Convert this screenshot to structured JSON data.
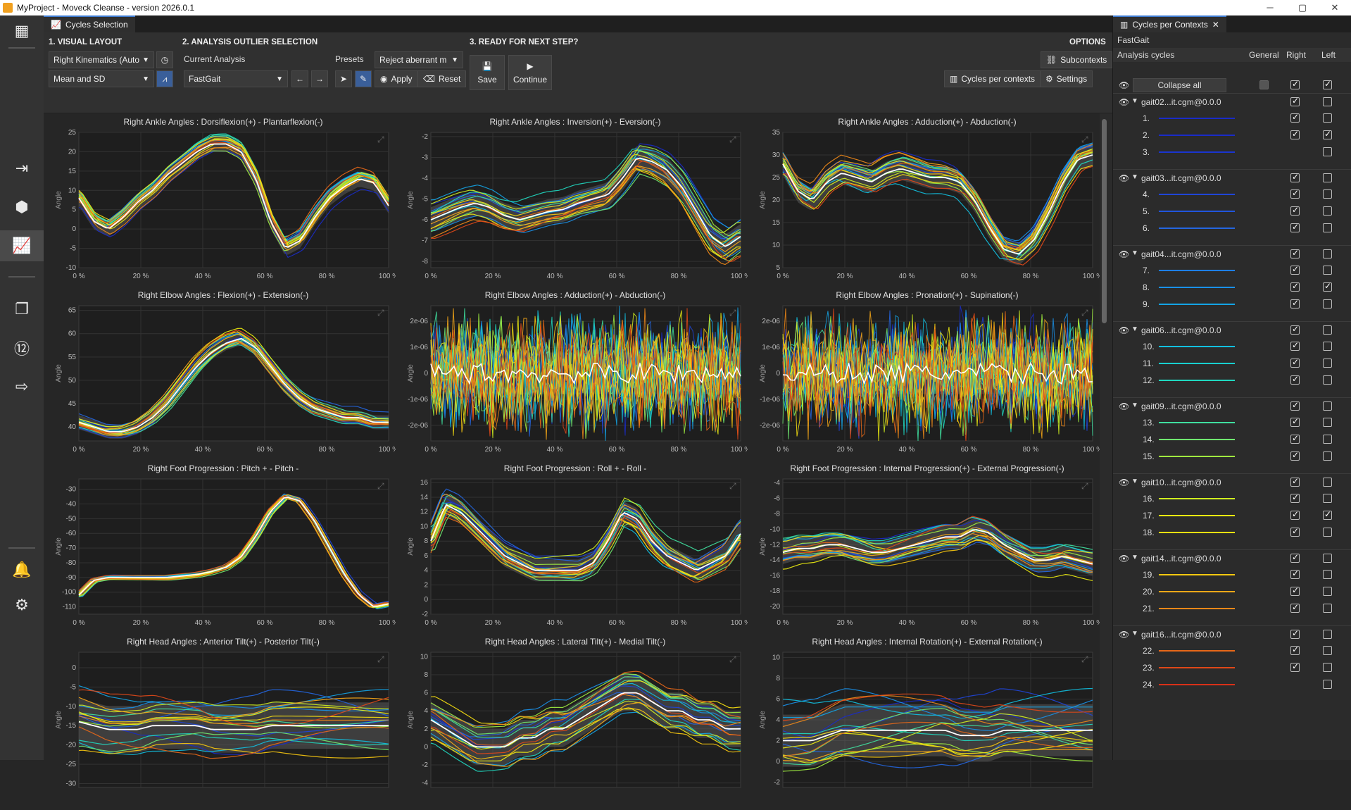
{
  "window": {
    "title": "MyProject - Moveck Cleanse - version 2026.0.1",
    "minimize": "─",
    "maximize": "▢",
    "close": "✕"
  },
  "main_tab": "Cycles Selection",
  "toolbar": {
    "visual_layout_title": "1. VISUAL LAYOUT",
    "analysis_title": "2. ANALYSIS OUTLIER SELECTION",
    "ready_title": "3. READY FOR NEXT STEP?",
    "options_title": "OPTIONS",
    "layout_select": "Right Kinematics (Auto",
    "stat_select": "Mean and SD",
    "current_analysis_label": "Current Analysis",
    "analysis_select": "FastGait",
    "presets_label": "Presets",
    "presets_select": "Reject aberrant m",
    "apply_label": "Apply",
    "reset_label": "Reset",
    "save_label": "Save",
    "continue_label": "Continue",
    "subcontexts_label": "Subcontexts",
    "cycles_per_contexts_label": "Cycles per contexts",
    "settings_label": "Settings"
  },
  "right_panel": {
    "tab_title": "Cycles per Contexts",
    "analysis_name": "FastGait",
    "headers": {
      "cycles": "Analysis cycles",
      "general": "General",
      "right": "Right",
      "left": "Left"
    },
    "collapse_all": "Collapse all",
    "groups": [
      {
        "name": "gait02...it.cgm@0.0.0",
        "cycles": [
          {
            "n": "1.",
            "color": "#1a2bc8",
            "right": true,
            "left": false
          },
          {
            "n": "2.",
            "color": "#1a2bc8",
            "right": true,
            "left": true
          },
          {
            "n": "3.",
            "color": "#1a35d0",
            "right": false,
            "left": false
          }
        ]
      },
      {
        "name": "gait03...it.cgm@0.0.0",
        "cycles": [
          {
            "n": "4.",
            "color": "#1f45d8",
            "right": true,
            "left": false
          },
          {
            "n": "5.",
            "color": "#2155de",
            "right": true,
            "left": false
          },
          {
            "n": "6.",
            "color": "#2466e0",
            "right": true,
            "left": false
          }
        ]
      },
      {
        "name": "gait04...it.cgm@0.0.0",
        "cycles": [
          {
            "n": "7.",
            "color": "#1e7fe6",
            "right": true,
            "left": false
          },
          {
            "n": "8.",
            "color": "#1a90e8",
            "right": true,
            "left": true
          },
          {
            "n": "9.",
            "color": "#14a4e6",
            "right": true,
            "left": false
          }
        ]
      },
      {
        "name": "gait06...it.cgm@0.0.0",
        "cycles": [
          {
            "n": "10.",
            "color": "#12c0e0",
            "right": true,
            "left": false
          },
          {
            "n": "11.",
            "color": "#18d0d0",
            "right": true,
            "left": false
          },
          {
            "n": "12.",
            "color": "#20d8c0",
            "right": true,
            "left": false
          }
        ]
      },
      {
        "name": "gait09...it.cgm@0.0.0",
        "cycles": [
          {
            "n": "13.",
            "color": "#40e0a0",
            "right": true,
            "left": false
          },
          {
            "n": "14.",
            "color": "#70e870",
            "right": true,
            "left": false
          },
          {
            "n": "15.",
            "color": "#a0ee40",
            "right": true,
            "left": false
          }
        ]
      },
      {
        "name": "gait10...it.cgm@0.0.0",
        "cycles": [
          {
            "n": "16.",
            "color": "#d0f020",
            "right": true,
            "left": false
          },
          {
            "n": "17.",
            "color": "#f0f010",
            "right": true,
            "left": true
          },
          {
            "n": "18.",
            "color": "#f8e010",
            "right": true,
            "left": false
          }
        ]
      },
      {
        "name": "gait14...it.cgm@0.0.0",
        "cycles": [
          {
            "n": "19.",
            "color": "#f8c810",
            "right": true,
            "left": false
          },
          {
            "n": "20.",
            "color": "#f8a818",
            "right": true,
            "left": false
          },
          {
            "n": "21.",
            "color": "#f08818",
            "right": true,
            "left": false
          }
        ]
      },
      {
        "name": "gait16...it.cgm@0.0.0",
        "cycles": [
          {
            "n": "22.",
            "color": "#e86818",
            "right": true,
            "left": false
          },
          {
            "n": "23.",
            "color": "#e04818",
            "right": true,
            "left": false
          },
          {
            "n": "24.",
            "color": "#d83018",
            "right": false,
            "left": false
          }
        ]
      }
    ]
  },
  "chart_data": [
    {
      "type": "line",
      "title": "Right Ankle Angles : Dorsiflexion(+) - Plantarflexion(-)",
      "ylabel": "Angle",
      "xticks": [
        "0 %",
        "20 %",
        "40 %",
        "60 %",
        "80 %",
        "100 %"
      ],
      "yticks": [
        "25",
        "20",
        "15",
        "10",
        "5",
        "0",
        "-5",
        "-10"
      ],
      "ylim": [
        -10,
        25
      ],
      "mean": [
        8,
        2,
        0,
        3,
        7,
        10,
        14,
        17,
        20,
        22,
        22,
        20,
        13,
        2,
        -5,
        -3,
        3,
        8,
        11,
        13,
        12,
        6
      ],
      "spread": 2
    },
    {
      "type": "line",
      "title": "Right Ankle Angles : Inversion(+) - Eversion(-)",
      "ylabel": "Angle",
      "xticks": [
        "0 %",
        "20 %",
        "40 %",
        "60 %",
        "80 %",
        "100 %"
      ],
      "yticks": [
        "-2",
        "-3",
        "-4",
        "-5",
        "-6",
        "-7",
        "-8"
      ],
      "ylim": [
        -8.3,
        -1.8
      ],
      "mean": [
        -6,
        -5.7,
        -5.4,
        -5.2,
        -5.4,
        -5.8,
        -6,
        -5.8,
        -5.6,
        -5.5,
        -5.2,
        -5,
        -4.8,
        -4,
        -3,
        -3.2,
        -3.6,
        -4.4,
        -5.6,
        -6.8,
        -7.3,
        -6.8
      ],
      "spread": 0.6
    },
    {
      "type": "line",
      "title": "Right Ankle Angles : Adduction(+) - Abduction(-)",
      "ylabel": "Angle",
      "xticks": [
        "0 %",
        "20 %",
        "40 %",
        "60 %",
        "80 %",
        "100 %"
      ],
      "yticks": [
        "35",
        "30",
        "25",
        "20",
        "15",
        "10",
        "5"
      ],
      "ylim": [
        5,
        35
      ],
      "mean": [
        28,
        22,
        20,
        24,
        26,
        25,
        24,
        26,
        27,
        26,
        25,
        25,
        24,
        20,
        14,
        9,
        8,
        11,
        17,
        24,
        29,
        30
      ],
      "spread": 2.5
    },
    {
      "type": "line",
      "title": "Right Elbow Angles : Flexion(+) - Extension(-)",
      "ylabel": "Angle",
      "xticks": [
        "0 %",
        "20 %",
        "40 %",
        "60 %",
        "80 %",
        "100 %"
      ],
      "yticks": [
        "65",
        "60",
        "55",
        "50",
        "45",
        "40"
      ],
      "ylim": [
        37,
        66
      ],
      "mean": [
        41,
        40,
        39,
        39,
        40,
        42,
        45,
        49,
        53,
        56,
        58,
        59,
        57,
        53,
        49,
        46,
        44,
        43,
        42,
        42,
        41,
        41
      ],
      "spread": 1.5
    },
    {
      "type": "noise",
      "title": "Right Elbow Angles : Adduction(+) - Abduction(-)",
      "ylabel": "Angle",
      "xticks": [
        "0 %",
        "20 %",
        "40 %",
        "60 %",
        "80 %",
        "100 %"
      ],
      "yticks": [
        "2e-06",
        "1e-06",
        "0",
        "-1e-06",
        "-2e-06"
      ],
      "ylim": [
        -2.6,
        2.6
      ]
    },
    {
      "type": "noise",
      "title": "Right Elbow Angles : Pronation(+) - Supination(-)",
      "ylabel": "Angle",
      "xticks": [
        "0 %",
        "20 %",
        "40 %",
        "60 %",
        "80 %",
        "100 %"
      ],
      "yticks": [
        "2e-06",
        "1e-06",
        "0",
        "-1e-06",
        "-2e-06"
      ],
      "ylim": [
        -2.6,
        2.6
      ]
    },
    {
      "type": "line",
      "title": "Right Foot Progression : Pitch + - Pitch -",
      "ylabel": "Angle",
      "xticks": [
        "0 %",
        "20 %",
        "40 %",
        "60 %",
        "80 %",
        "100 %"
      ],
      "yticks": [
        "-30",
        "-40",
        "-50",
        "-60",
        "-70",
        "-80",
        "-90",
        "-100",
        "-110"
      ],
      "ylim": [
        -115,
        -23
      ],
      "mean": [
        -102,
        -92,
        -90,
        -90,
        -90,
        -90,
        -90,
        -89,
        -88,
        -86,
        -83,
        -76,
        -62,
        -45,
        -35,
        -38,
        -52,
        -70,
        -88,
        -102,
        -110,
        -108
      ],
      "spread": 1.5
    },
    {
      "type": "line",
      "title": "Right Foot Progression : Roll + - Roll -",
      "ylabel": "Angle",
      "xticks": [
        "0 %",
        "20 %",
        "40 %",
        "60 %",
        "80 %",
        "100 %"
      ],
      "yticks": [
        "16",
        "14",
        "12",
        "10",
        "8",
        "6",
        "4",
        "2",
        "0",
        "-2"
      ],
      "ylim": [
        -2,
        16.5
      ],
      "mean": [
        8,
        13,
        12,
        10,
        8,
        6,
        5,
        4,
        4,
        4,
        4,
        5,
        8,
        12,
        11,
        8,
        6,
        5,
        4,
        5,
        6,
        9
      ],
      "spread": 1.5
    },
    {
      "type": "line",
      "title": "Right Foot Progression : Internal Progression(+) - External Progression(-)",
      "ylabel": "Angle",
      "xticks": [
        "0 %",
        "20 %",
        "40 %",
        "60 %",
        "80 %",
        "100 %"
      ],
      "yticks": [
        "-4",
        "-6",
        "-8",
        "-10",
        "-12",
        "-14",
        "-16",
        "-18",
        "-20"
      ],
      "ylim": [
        -21,
        -3.5
      ],
      "mean": [
        -13,
        -12.5,
        -12.5,
        -12,
        -12,
        -12.5,
        -13,
        -13,
        -12.5,
        -12,
        -11.5,
        -11,
        -11,
        -10,
        -10.5,
        -12,
        -13,
        -14,
        -14,
        -13.5,
        -14,
        -14.5
      ],
      "spread": 1.5
    },
    {
      "type": "line",
      "title": "Right Head Angles : Anterior Tilt(+) - Posterior Tilt(-)",
      "ylabel": "Angle",
      "xticks": [],
      "yticks": [
        "0",
        "-5",
        "-10",
        "-15",
        "-20",
        "-25",
        "-30"
      ],
      "ylim": [
        -31,
        4
      ],
      "mean": [
        -14,
        -15,
        -16,
        -16,
        -16,
        -15,
        -15,
        -15,
        -15,
        -16,
        -16,
        -16,
        -16,
        -15,
        -15,
        -15,
        -15,
        -15,
        -15,
        -15,
        -15,
        -15
      ],
      "spread": 6
    },
    {
      "type": "line",
      "title": "Right Head Angles : Lateral Tilt(+) - Medial Tilt(-)",
      "ylabel": "Angle",
      "xticks": [],
      "yticks": [
        "10",
        "8",
        "6",
        "4",
        "2",
        "0",
        "-2",
        "-4"
      ],
      "ylim": [
        -4.5,
        10.5
      ],
      "mean": [
        3,
        2,
        1,
        0,
        0,
        0,
        1,
        1,
        2,
        2,
        3,
        4,
        5,
        6,
        6,
        5,
        4,
        4,
        3,
        3,
        2,
        2
      ],
      "spread": 2
    },
    {
      "type": "line",
      "title": "Right Head Angles : Internal Rotation(+) - External Rotation(-)",
      "ylabel": "Angle",
      "xticks": [],
      "yticks": [
        "10",
        "8",
        "6",
        "4",
        "2",
        "0",
        "-2"
      ],
      "ylim": [
        -2.5,
        10.5
      ],
      "mean": [
        2,
        2,
        2,
        2.5,
        3,
        3,
        3,
        3,
        3,
        3,
        3,
        3,
        2.5,
        2.5,
        2.5,
        3,
        3,
        3,
        3,
        3,
        3,
        3
      ],
      "spread": 2.5
    }
  ],
  "palette": [
    "#1a2bc8",
    "#1f45d8",
    "#2466e0",
    "#1a90e8",
    "#14a4e6",
    "#12c0e0",
    "#20d8c0",
    "#40e0a0",
    "#70e870",
    "#a0ee40",
    "#d0f020",
    "#f0f010",
    "#f8e010",
    "#f8c810",
    "#f8a818",
    "#f08818",
    "#e86818",
    "#e04818"
  ],
  "accent": "#3d7bd1"
}
